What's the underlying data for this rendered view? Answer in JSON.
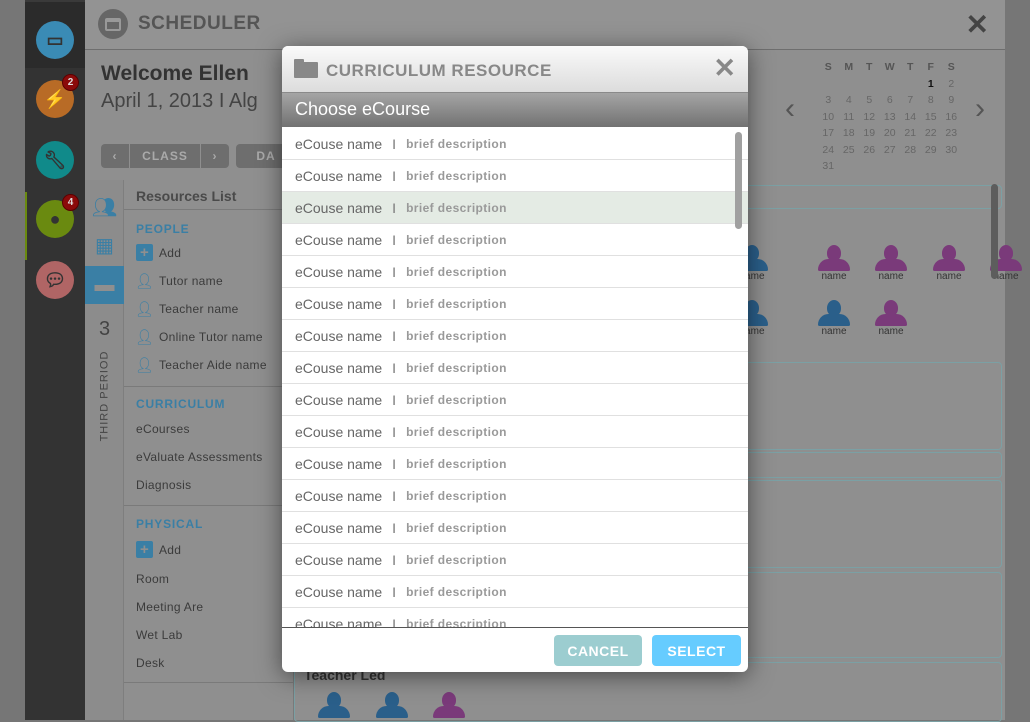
{
  "sidebar": {
    "apps": [
      {
        "name": "calendar",
        "color": "#3a8bb5"
      },
      {
        "name": "lightning",
        "color": "#b86b26",
        "badge": "2"
      },
      {
        "name": "wrench",
        "color": "#108a8a"
      },
      {
        "name": "person",
        "color": "#6a8a10",
        "badge": "4"
      },
      {
        "name": "chat",
        "color": "#b06565"
      }
    ]
  },
  "header": {
    "title": "SCHEDULER"
  },
  "welcome": {
    "greeting": "Welcome Ellen",
    "date": "April 1, 2013  I  Alg"
  },
  "nav": {
    "class_label": "CLASS",
    "day_label": "DA"
  },
  "calendar": {
    "weekdays": [
      "S",
      "M",
      "T",
      "W",
      "T",
      "F",
      "S"
    ],
    "days": [
      "",
      "",
      "",
      "",
      "",
      "1",
      "2",
      "3",
      "4",
      "5",
      "6",
      "7",
      "8",
      "9",
      "10",
      "11",
      "12",
      "13",
      "14",
      "15",
      "16",
      "17",
      "18",
      "19",
      "20",
      "21",
      "22",
      "23",
      "24",
      "25",
      "26",
      "27",
      "28",
      "29",
      "30",
      "31"
    ],
    "today": "1"
  },
  "tabs": {
    "period_number": "3",
    "period_label": "THIRD PERIOD"
  },
  "resources": {
    "title": "Resources List",
    "people_label": "PEOPLE",
    "people": [
      "Add",
      "Tutor name",
      "Teacher name",
      "Online Tutor name",
      "Teacher Aide name"
    ],
    "curriculum_label": "CURRICULUM",
    "curriculum": [
      "eCourses",
      "eValuate Assessments",
      "Diagnosis"
    ],
    "physical_label": "PHYSICAL",
    "physical": [
      "Add",
      "Room",
      "Meeting Are",
      "Wet Lab",
      "Desk"
    ]
  },
  "content": {
    "person_label": "name",
    "teacher_led": "Teacher Led",
    "colors": {
      "blue": "#2a5f8a",
      "purple": "#7a3a7a"
    }
  },
  "modal": {
    "title": "CURRICULUM RESOURCE",
    "subtitle": "Choose eCourse",
    "items": [
      {
        "name": "eCouse name",
        "desc": "brief description"
      },
      {
        "name": "eCouse name",
        "desc": "brief description"
      },
      {
        "name": "eCouse name",
        "desc": "brief description",
        "selected": true
      },
      {
        "name": "eCouse name",
        "desc": "brief description"
      },
      {
        "name": "eCouse name",
        "desc": "brief description"
      },
      {
        "name": "eCouse name",
        "desc": "brief description"
      },
      {
        "name": "eCouse name",
        "desc": "brief description"
      },
      {
        "name": "eCouse name",
        "desc": "brief description"
      },
      {
        "name": "eCouse name",
        "desc": "brief description"
      },
      {
        "name": "eCouse name",
        "desc": "brief description"
      },
      {
        "name": "eCouse name",
        "desc": "brief description"
      },
      {
        "name": "eCouse name",
        "desc": "brief description"
      },
      {
        "name": "eCouse name",
        "desc": "brief description"
      },
      {
        "name": "eCouse name",
        "desc": "brief description"
      },
      {
        "name": "eCouse name",
        "desc": "brief description"
      },
      {
        "name": "eCouse name",
        "desc": "brief description"
      }
    ],
    "separator": "I",
    "cancel_label": "CANCEL",
    "select_label": "SELECT",
    "cancel_color": "#9ccdd0",
    "select_color": "#66ccff"
  }
}
